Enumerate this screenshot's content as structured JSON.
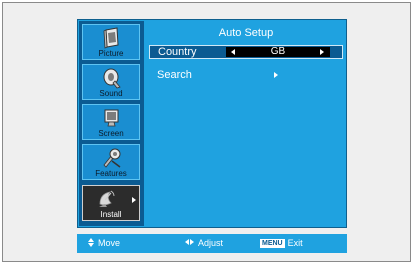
{
  "sidebar": {
    "items": [
      {
        "label": "Picture",
        "icon": "picture-icon"
      },
      {
        "label": "Sound",
        "icon": "sound-icon"
      },
      {
        "label": "Screen",
        "icon": "screen-icon"
      },
      {
        "label": "Features",
        "icon": "features-icon"
      },
      {
        "label": "Install",
        "icon": "install-icon",
        "selected": true
      }
    ]
  },
  "main": {
    "title": "Auto Setup",
    "rows": [
      {
        "label": "Country",
        "value": "GB"
      },
      {
        "label": "Search"
      }
    ]
  },
  "footer": {
    "move": "Move",
    "adjust": "Adjust",
    "menu_key": "MENU",
    "exit": "Exit"
  },
  "colors": {
    "osd_blue": "#1fa2e0",
    "dark_blue": "#0b5b92",
    "selected_bg": "#2c2c2c"
  }
}
